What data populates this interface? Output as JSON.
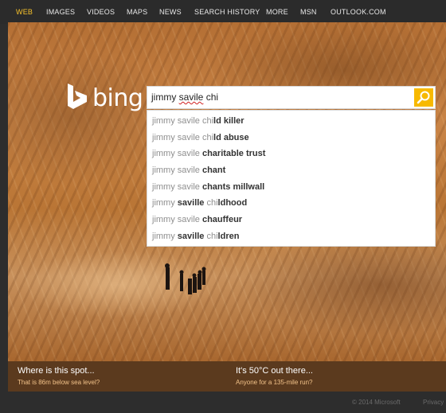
{
  "nav": {
    "items": [
      "WEB",
      "IMAGES",
      "VIDEOS",
      "MAPS",
      "NEWS",
      "SEARCH HISTORY",
      "MORE",
      "MSN",
      "OUTLOOK.COM"
    ],
    "active": "WEB",
    "active_color": "#f7c22b"
  },
  "logo": {
    "text": "bing"
  },
  "search": {
    "value_prefix": "jimmy ",
    "value_misspelled": "savile",
    "value_suffix": " chi",
    "button_icon": "search-icon",
    "button_color": "#f7b900"
  },
  "suggestions": [
    {
      "typed": "jimmy savile chi",
      "completion": "ld killer"
    },
    {
      "typed": "jimmy savile chi",
      "completion": "ld abuse"
    },
    {
      "typed": "jimmy savile ",
      "completion": "charitable trust"
    },
    {
      "typed": "jimmy savile ",
      "completion": "chant"
    },
    {
      "typed": "jimmy savile ",
      "completion": "chants millwall"
    },
    {
      "typed": "jimmy ",
      "completion_mid": "saville",
      "typed2": " chi",
      "completion": "ldhood"
    },
    {
      "typed": "jimmy savile ",
      "completion": "chauffeur"
    },
    {
      "typed": "jimmy ",
      "completion_mid": "saville",
      "typed2": " chi",
      "completion": "ldren"
    }
  ],
  "captions": {
    "left": {
      "title": "Where is this spot...",
      "link": "That is 86m below sea level?"
    },
    "right": {
      "title": "It's 50°C out there...",
      "link": "Anyone for a 135-mile run?"
    }
  },
  "footer": {
    "copyright": "© 2014 Microsoft",
    "privacy": "Privacy"
  }
}
